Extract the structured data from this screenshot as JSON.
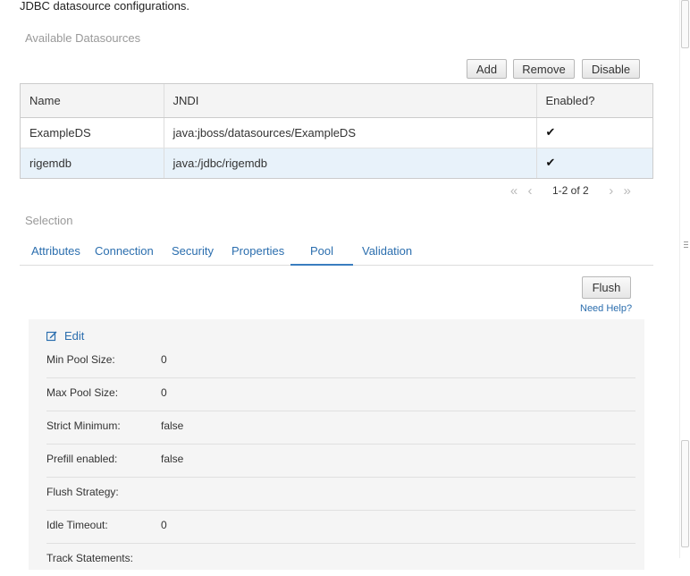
{
  "description": "JDBC datasource configurations.",
  "available_title": "Available Datasources",
  "toolbar": {
    "add": "Add",
    "remove": "Remove",
    "disable": "Disable"
  },
  "table": {
    "headers": [
      "Name",
      "JNDI",
      "Enabled?"
    ],
    "rows": [
      {
        "name": "ExampleDS",
        "jndi": "java:jboss/datasources/ExampleDS",
        "enabled": "✔"
      },
      {
        "name": "rigemdb",
        "jndi": "java:/jdbc/rigemdb",
        "enabled": "✔"
      }
    ]
  },
  "pager": {
    "label": "1-2 of 2"
  },
  "selection_title": "Selection",
  "tabs": [
    "Attributes",
    "Connection",
    "Security",
    "Properties",
    "Pool",
    "Validation"
  ],
  "active_tab": "Pool",
  "flush_label": "Flush",
  "help_label": "Need Help?",
  "edit_label": "Edit",
  "pool": [
    {
      "key": "Min Pool Size:",
      "value": "0"
    },
    {
      "key": "Max Pool Size:",
      "value": "0"
    },
    {
      "key": "Strict Minimum:",
      "value": "false"
    },
    {
      "key": "Prefill enabled:",
      "value": "false"
    },
    {
      "key": "Flush Strategy:",
      "value": ""
    },
    {
      "key": "Idle Timeout:",
      "value": "0"
    },
    {
      "key": "Track Statements:",
      "value": ""
    }
  ]
}
